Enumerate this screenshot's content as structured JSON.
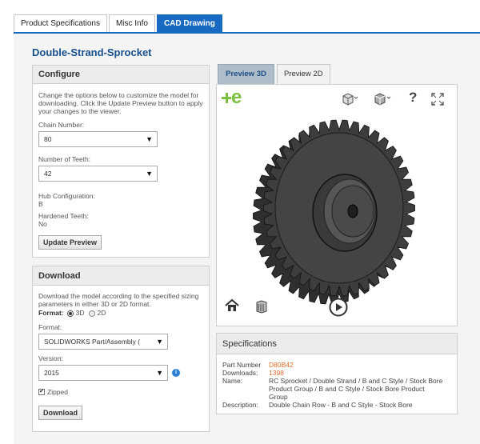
{
  "tabs": [
    {
      "label": "Product Specifications"
    },
    {
      "label": "Misc Info"
    },
    {
      "label": "CAD Drawing"
    }
  ],
  "page_title": "Double-Strand-Sprocket",
  "configure": {
    "heading": "Configure",
    "description": "Change the options below to customize the model for downloading. Click the Update Preview button to apply your changes to the viewer.",
    "chain_number_label": "Chain Number:",
    "chain_number_value": "80",
    "teeth_label": "Number of Teeth:",
    "teeth_value": "42",
    "hub_label": "Hub Configuration:",
    "hub_value": "B",
    "hardened_label": "Hardened Teeth:",
    "hardened_value": "No",
    "update_button": "Update Preview"
  },
  "download": {
    "heading": "Download",
    "description": "Download the model according to the specified sizing parameters in either 3D or 2D format.",
    "format_label": "Format:",
    "option_3d": "3D",
    "option_2d": "2D",
    "format_field_label": "Format:",
    "format_value": "SOLIDWORKS Part/Assembly (",
    "version_label": "Version:",
    "version_value": "2015",
    "zipped_label": "Zipped",
    "download_button": "Download"
  },
  "viewer": {
    "tab_3d": "Preview 3D",
    "tab_2d": "Preview 2D",
    "logo": "e",
    "help": "?"
  },
  "specifications": {
    "heading": "Specifications",
    "part_number_label": "Part Number",
    "part_number_value": "D80B42",
    "downloads_label": "Downloads:",
    "downloads_value": "1398",
    "name_label": "Name:",
    "name_value": "RC Sprocket / Double Strand / B and C Style / Stock Bore Product Group / B and C Style / Stock Bore Product Group",
    "description_label": "Description:",
    "description_value": "Double Chain Row - B and C Style - Stock Bore"
  },
  "colors": {
    "brand_blue": "#1769c2",
    "title_blue": "#16508f",
    "accent_orange": "#e06a2c",
    "logo_green": "#7bc043"
  }
}
